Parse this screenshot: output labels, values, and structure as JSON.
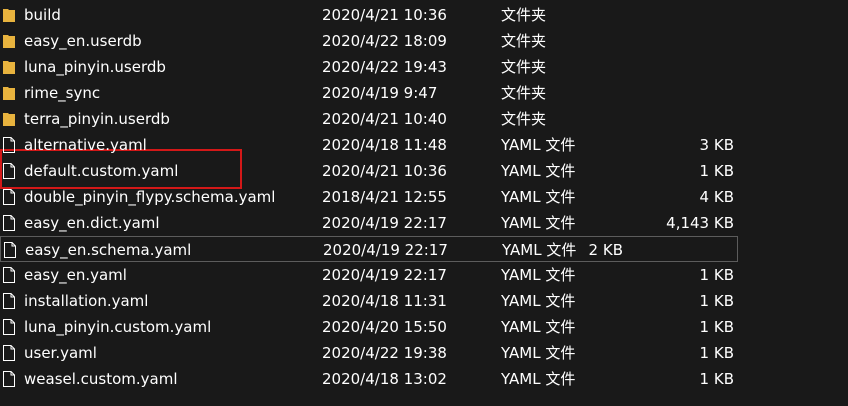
{
  "colors": {
    "background": "#191919",
    "text": "#ffffff",
    "folder": "#e8b33e",
    "file": "#ffffff",
    "highlight": "#d31818",
    "focus_border": "#5c5c5c"
  },
  "files": [
    {
      "name": "build",
      "date": "2020/4/21 10:36",
      "type": "文件夹",
      "size": "",
      "icon": "folder-icon"
    },
    {
      "name": "easy_en.userdb",
      "date": "2020/4/22 18:09",
      "type": "文件夹",
      "size": "",
      "icon": "folder-icon"
    },
    {
      "name": "luna_pinyin.userdb",
      "date": "2020/4/22 19:43",
      "type": "文件夹",
      "size": "",
      "icon": "folder-icon"
    },
    {
      "name": "rime_sync",
      "date": "2020/4/19 9:47",
      "type": "文件夹",
      "size": "",
      "icon": "folder-icon"
    },
    {
      "name": "terra_pinyin.userdb",
      "date": "2020/4/21 10:40",
      "type": "文件夹",
      "size": "",
      "icon": "folder-icon"
    },
    {
      "name": "alternative.yaml",
      "date": "2020/4/18 11:48",
      "type": "YAML 文件",
      "size": "3 KB",
      "icon": "file-icon"
    },
    {
      "name": "default.custom.yaml",
      "date": "2020/4/21 10:36",
      "type": "YAML 文件",
      "size": "1 KB",
      "icon": "file-icon"
    },
    {
      "name": "double_pinyin_flypy.schema.yaml",
      "date": "2018/4/21 12:55",
      "type": "YAML 文件",
      "size": "4 KB",
      "icon": "file-icon"
    },
    {
      "name": "easy_en.dict.yaml",
      "date": "2020/4/19 22:17",
      "type": "YAML 文件",
      "size": "4,143 KB",
      "icon": "file-icon"
    },
    {
      "name": "easy_en.schema.yaml",
      "date": "2020/4/19 22:17",
      "type": "YAML 文件",
      "size": "2 KB",
      "icon": "file-icon"
    },
    {
      "name": "easy_en.yaml",
      "date": "2020/4/19 22:17",
      "type": "YAML 文件",
      "size": "1 KB",
      "icon": "file-icon"
    },
    {
      "name": "installation.yaml",
      "date": "2020/4/18 11:31",
      "type": "YAML 文件",
      "size": "1 KB",
      "icon": "file-icon"
    },
    {
      "name": "luna_pinyin.custom.yaml",
      "date": "2020/4/20 15:50",
      "type": "YAML 文件",
      "size": "1 KB",
      "icon": "file-icon"
    },
    {
      "name": "user.yaml",
      "date": "2020/4/22 19:38",
      "type": "YAML 文件",
      "size": "1 KB",
      "icon": "file-icon"
    },
    {
      "name": "weasel.custom.yaml",
      "date": "2020/4/18 13:02",
      "type": "YAML 文件",
      "size": "1 KB",
      "icon": "file-icon"
    }
  ],
  "focused_row": 9,
  "highlighted_row": 6
}
